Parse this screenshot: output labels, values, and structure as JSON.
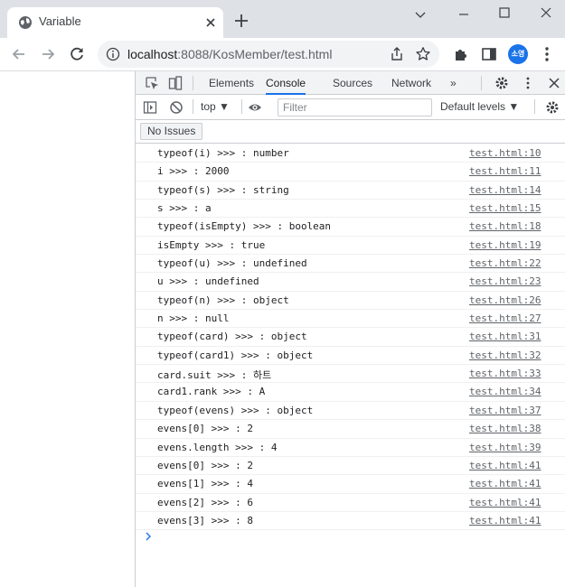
{
  "browser": {
    "tab_title": "Variable",
    "url_host": "localhost",
    "url_rest": ":8088/KosMember/test.html",
    "profile_initials": "소영"
  },
  "devtools": {
    "tabs": [
      "Elements",
      "Console",
      "Sources",
      "Network"
    ],
    "more_tabs": "»",
    "active_tab": "Console",
    "context": "top",
    "filter_placeholder": "Filter",
    "levels": "Default levels",
    "issues_button": "No Issues"
  },
  "console": {
    "messages": [
      {
        "text": "typeof(i) >>> : number",
        "src": "test.html:10"
      },
      {
        "text": "i >>> : 2000",
        "src": "test.html:11"
      },
      {
        "text": "typeof(s) >>> : string",
        "src": "test.html:14"
      },
      {
        "text": "s >>> : a",
        "src": "test.html:15"
      },
      {
        "text": "typeof(isEmpty) >>> : boolean",
        "src": "test.html:18"
      },
      {
        "text": "isEmpty >>> : true",
        "src": "test.html:19"
      },
      {
        "text": "typeof(u) >>> : undefined",
        "src": "test.html:22"
      },
      {
        "text": "u >>> : undefined",
        "src": "test.html:23"
      },
      {
        "text": "typeof(n) >>> : object",
        "src": "test.html:26"
      },
      {
        "text": "n >>> : null",
        "src": "test.html:27"
      },
      {
        "text": "typeof(card) >>> : object",
        "src": "test.html:31"
      },
      {
        "text": "typeof(card1) >>> : object",
        "src": "test.html:32"
      },
      {
        "text": "card.suit >>> : 하트",
        "src": "test.html:33"
      },
      {
        "text": "card1.rank >>> : A",
        "src": "test.html:34"
      },
      {
        "text": "typeof(evens) >>> : object",
        "src": "test.html:37"
      },
      {
        "text": "evens[0] >>> : 2",
        "src": "test.html:38"
      },
      {
        "text": "evens.length >>> : 4",
        "src": "test.html:39"
      },
      {
        "text": "evens[0] >>> : 2",
        "src": "test.html:41"
      },
      {
        "text": "evens[1] >>> : 4",
        "src": "test.html:41"
      },
      {
        "text": "evens[2] >>> : 6",
        "src": "test.html:41"
      },
      {
        "text": "evens[3] >>> : 8",
        "src": "test.html:41"
      }
    ]
  },
  "colors": {
    "accent": "#1a73e8",
    "chrome_bg": "#dee1e6",
    "omnibox_bg": "#f1f3f4",
    "link": "#5f6368"
  }
}
